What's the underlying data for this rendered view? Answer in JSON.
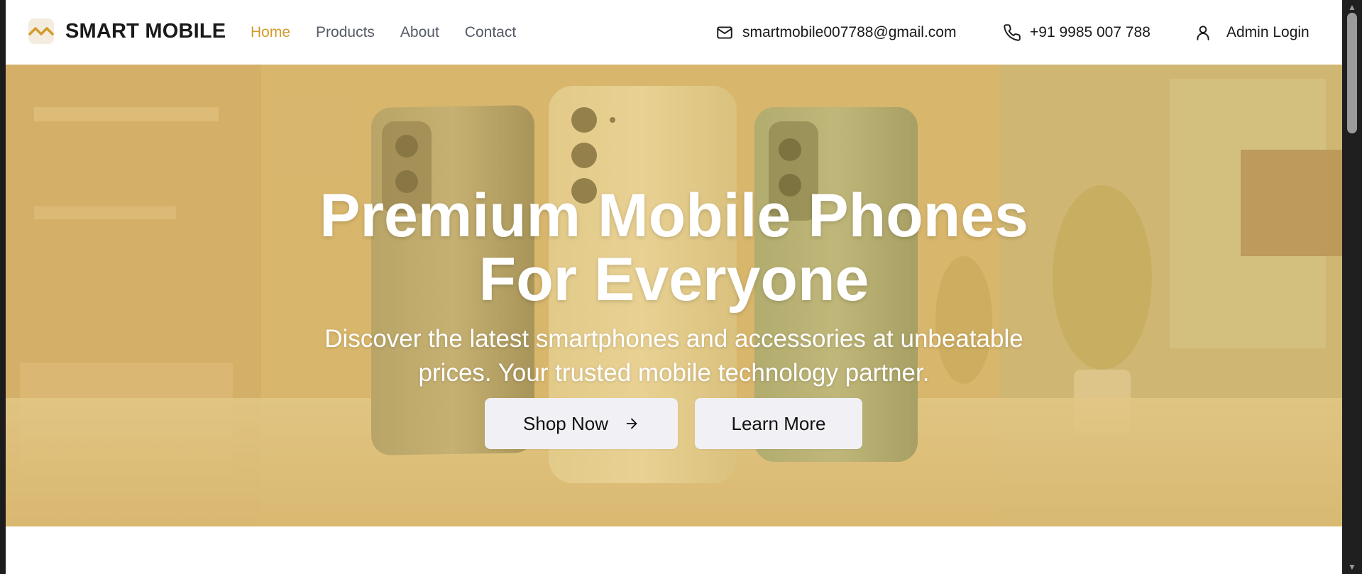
{
  "navbar": {
    "brand_name": "SMART MOBILE",
    "links": [
      {
        "label": "Home",
        "active": true
      },
      {
        "label": "Products",
        "active": false
      },
      {
        "label": "About",
        "active": false
      },
      {
        "label": "Contact",
        "active": false
      }
    ],
    "email": "smartmobile007788@gmail.com",
    "phone": "+91 9985 007 788",
    "admin_login": "Admin Login",
    "icons": {
      "email": "mail-icon",
      "phone": "phone-icon",
      "admin": "user-icon"
    }
  },
  "hero": {
    "title_line1": "Premium Mobile Phones",
    "title_line2": "For Everyone",
    "subtitle_line1": "Discover the latest smartphones and accessories at unbeatable",
    "subtitle_line2": "prices. Your trusted mobile technology partner.",
    "primary_button": "Shop Now",
    "secondary_button": "Learn More"
  },
  "colors": {
    "accent": "#d39b2c",
    "nav_text": "#555b66",
    "button_bg": "#f1f1f5",
    "hero_overlay": "#d6a846"
  }
}
